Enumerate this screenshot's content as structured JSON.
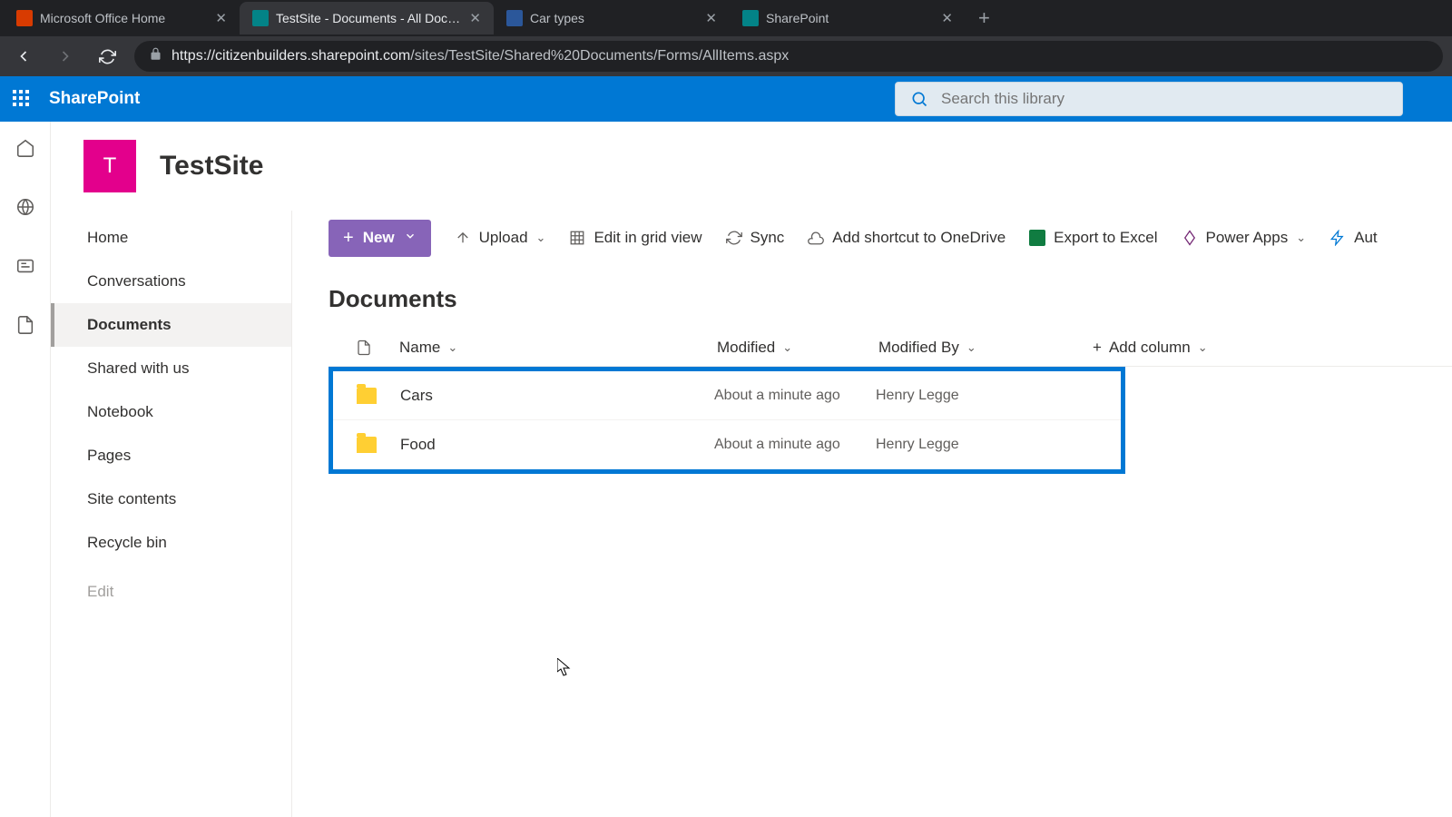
{
  "browser": {
    "tabs": [
      {
        "title": "Microsoft Office Home",
        "favicon": "#d83b01"
      },
      {
        "title": "TestSite - Documents - All Docum",
        "favicon": "#038387",
        "active": true
      },
      {
        "title": "Car types",
        "favicon": "#2b579a"
      },
      {
        "title": "SharePoint",
        "favicon": "#038387"
      }
    ],
    "url_host": "https://citizenbuilders.sharepoint.com",
    "url_path": "/sites/TestSite/Shared%20Documents/Forms/AllItems.aspx"
  },
  "suite": {
    "brand": "SharePoint",
    "search_placeholder": "Search this library"
  },
  "site": {
    "logo_letter": "T",
    "title": "TestSite"
  },
  "left_nav": {
    "items": [
      "Home",
      "Conversations",
      "Documents",
      "Shared with us",
      "Notebook",
      "Pages",
      "Site contents",
      "Recycle bin"
    ],
    "selected_index": 2,
    "edit_label": "Edit"
  },
  "commands": {
    "new": "New",
    "upload": "Upload",
    "edit_grid": "Edit in grid view",
    "sync": "Sync",
    "shortcut": "Add shortcut to OneDrive",
    "export": "Export to Excel",
    "power_apps": "Power Apps",
    "automate": "Aut"
  },
  "library": {
    "title": "Documents",
    "columns": {
      "name": "Name",
      "modified": "Modified",
      "modified_by": "Modified By",
      "add": "Add column"
    },
    "rows": [
      {
        "name": "Cars",
        "modified": "About a minute ago",
        "by": "Henry Legge"
      },
      {
        "name": "Food",
        "modified": "About a minute ago",
        "by": "Henry Legge"
      }
    ]
  }
}
